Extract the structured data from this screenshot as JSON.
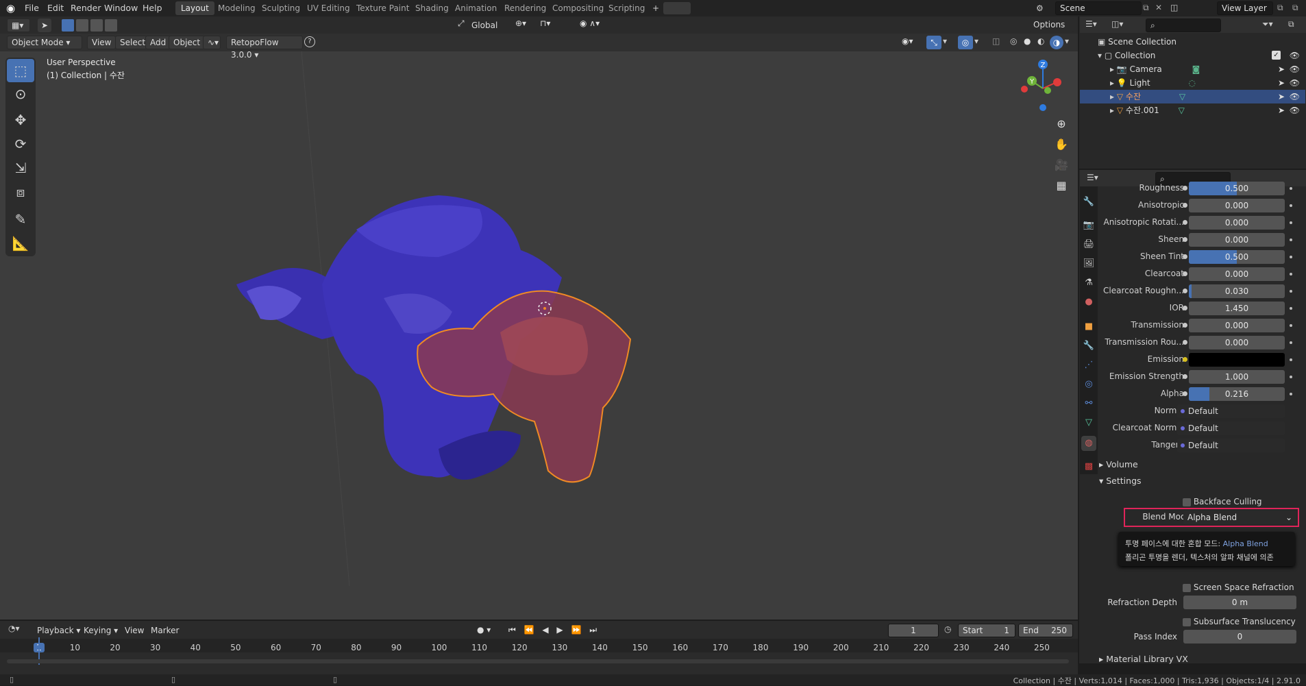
{
  "topbar": {
    "menus": [
      "File",
      "Edit",
      "Render",
      "Window",
      "Help"
    ],
    "workspaces": [
      "Layout",
      "Modeling",
      "Sculpting",
      "UV Editing",
      "Texture Paint",
      "Shading",
      "Animation",
      "Rendering",
      "Compositing",
      "Scripting"
    ],
    "active_workspace": "Layout",
    "add_tab": "+",
    "scene": "Scene",
    "view_layer": "View Layer"
  },
  "tool_header": {
    "orientation": "Global",
    "options": "Options"
  },
  "viewport_header": {
    "mode": "Object Mode",
    "menus": [
      "View",
      "Select",
      "Add",
      "Object"
    ],
    "addon": "RetopoFlow 3.0.0",
    "help": "?"
  },
  "viewport": {
    "perspective": "User Perspective",
    "collection_info": "(1) Collection | 수잔",
    "gizmo": {
      "z": "Z",
      "y": "Y",
      "x": "X"
    }
  },
  "outliner": {
    "items": [
      {
        "label": "Scene Collection",
        "icon": "scene-collection-icon"
      },
      {
        "label": "Collection",
        "icon": "collection-icon"
      },
      {
        "label": "Camera",
        "icon": "camera-icon"
      },
      {
        "label": "Light",
        "icon": "light-icon"
      },
      {
        "label": "수잔",
        "icon": "mesh-icon",
        "selected": true
      },
      {
        "label": "수잔.001",
        "icon": "mesh-icon"
      }
    ]
  },
  "properties": {
    "rows": [
      {
        "label": "Roughness",
        "value": "0.500",
        "fraction": 0.5
      },
      {
        "label": "Anisotropic",
        "value": "0.000",
        "fraction": 0
      },
      {
        "label": "Anisotropic Rotati...",
        "value": "0.000",
        "fraction": 0
      },
      {
        "label": "Sheen",
        "value": "0.000",
        "fraction": 0
      },
      {
        "label": "Sheen Tint",
        "value": "0.500",
        "fraction": 0.5
      },
      {
        "label": "Clearcoat",
        "value": "0.000",
        "fraction": 0
      },
      {
        "label": "Clearcoat Roughn...",
        "value": "0.030",
        "fraction": 0.03
      },
      {
        "label": "IOR",
        "value": "1.450",
        "fraction": 0
      },
      {
        "label": "Transmission",
        "value": "0.000",
        "fraction": 0
      },
      {
        "label": "Transmission Rou...",
        "value": "0.000",
        "fraction": 0
      },
      {
        "label": "Emission",
        "value": "",
        "fraction": 0,
        "color": "#000000"
      },
      {
        "label": "Emission Strength",
        "value": "1.000",
        "fraction": 0
      },
      {
        "label": "Alpha",
        "value": "0.216",
        "fraction": 0.216
      }
    ],
    "links": [
      {
        "label": "Normal",
        "value": "Default"
      },
      {
        "label": "Clearcoat Normal",
        "value": "Default"
      },
      {
        "label": "Tangent",
        "value": "Default"
      }
    ],
    "sections": {
      "volume": "Volume",
      "settings": "Settings",
      "material_library": "Material Library VX"
    },
    "settings": {
      "backface_culling": "Backface Culling",
      "blend_mode_label": "Blend Mode",
      "blend_mode_value": "Alpha Blend",
      "tooltip_line1": "투명 페이스에 대한 혼합 모드: ",
      "tooltip_line1_value": "Alpha Blend",
      "tooltip_line2": "폴리곤 투명을 렌더, 텍스처의 알파 채널에 의존",
      "screen_space_refraction": "Screen Space Refraction",
      "refraction_depth_label": "Refraction Depth",
      "refraction_depth_value": "0 m",
      "subsurface_translucency": "Subsurface Translucency",
      "pass_index_label": "Pass Index",
      "pass_index_value": "0"
    }
  },
  "timeline": {
    "menus": [
      "Playback",
      "Keying",
      "View",
      "Marker"
    ],
    "current_frame": "1",
    "start_label": "Start",
    "start_value": "1",
    "end_label": "End",
    "end_value": "250",
    "ticks": [
      "1",
      "10",
      "20",
      "30",
      "40",
      "50",
      "60",
      "70",
      "80",
      "90",
      "100",
      "110",
      "120",
      "130",
      "140",
      "150",
      "160",
      "170",
      "180",
      "190",
      "200",
      "210",
      "220",
      "230",
      "240",
      "250"
    ]
  },
  "statusbar": {
    "text": "Collection | 수잔 | Verts:1,014 | Faces:1,000 | Tris:1,936 | Objects:1/4 | 2.91.0"
  },
  "colors": {
    "accent": "#4772b3",
    "selection": "#f08a24",
    "highlight_box": "#e0245a",
    "monkey": "#3b32b8"
  }
}
